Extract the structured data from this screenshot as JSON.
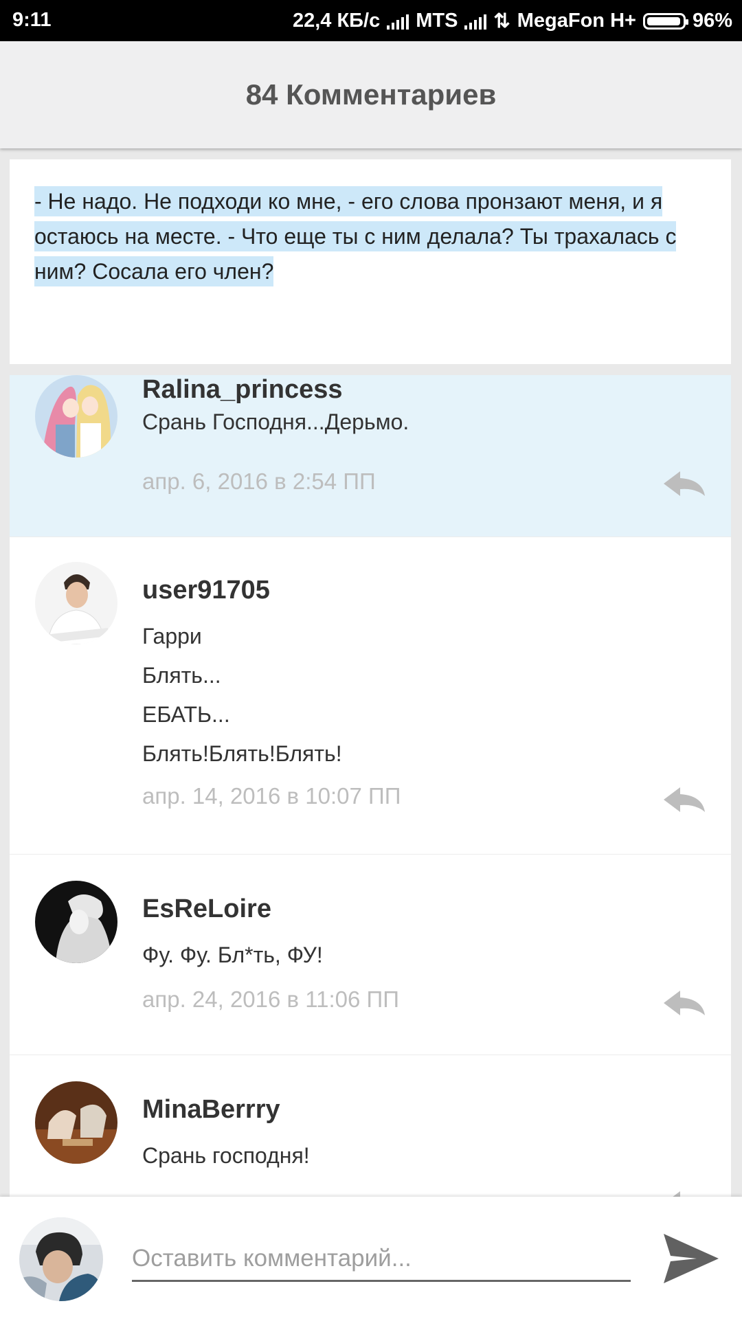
{
  "status_bar": {
    "time": "9:11",
    "speed": "22,4 КБ/с",
    "carrier1": "MTS",
    "carrier2": "MegaFon H+",
    "battery": "96%",
    "battery_level": 0.96
  },
  "header": {
    "title": "84 Комментариев"
  },
  "quote": {
    "text": "- Не надо. Не подходи ко мне, - его слова пронзают меня, и я остаюсь на месте. - Что еще ты с ним делала? Ты трахалась с ним? Сосала его член?"
  },
  "comments": [
    {
      "username": "Ralina_princess",
      "lines": [
        "Срань Господня...Дерьмо."
      ],
      "date": "апр. 6, 2016 в 2:54 ПП",
      "highlighted": true
    },
    {
      "username": "user91705",
      "lines": [
        "Гарри",
        "Блять...",
        "ЕБАТЬ...",
        "Блять!Блять!Блять!"
      ],
      "date": "апр. 14, 2016 в 10:07 ПП"
    },
    {
      "username": "EsReLoire",
      "lines": [
        "Фу. Фу. Бл*ть, ФУ!"
      ],
      "date": "апр. 24, 2016 в 11:06 ПП"
    },
    {
      "username": "MinaBerrry",
      "lines": [
        "Срань господня!"
      ],
      "date": ""
    }
  ],
  "compose": {
    "placeholder": "Оставить комментарий..."
  },
  "colors": {
    "highlight_bg": "#e5f3fa",
    "quote_highlight": "#cde8f9",
    "date_gray": "#bdbdbd",
    "title_gray": "#555555"
  }
}
